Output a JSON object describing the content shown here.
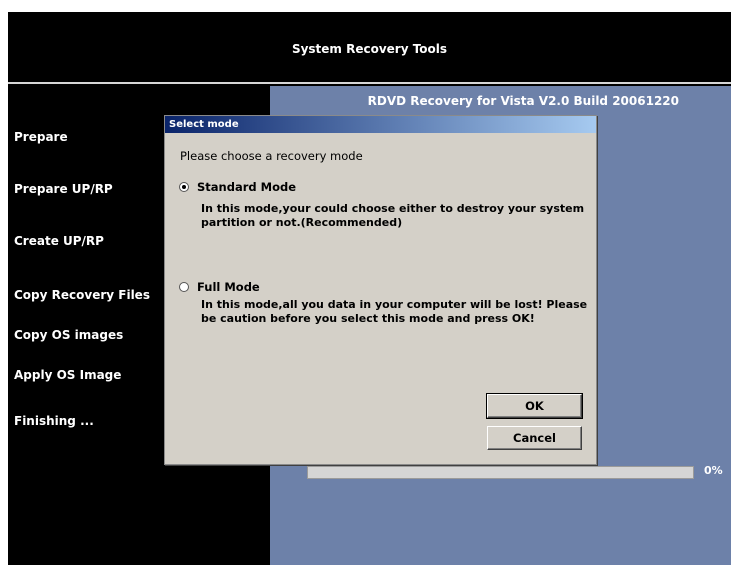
{
  "window": {
    "title": "System Recovery Tools"
  },
  "build_info": "RDVD Recovery for Vista V2.0 Build 20061220",
  "steps": [
    "Prepare",
    "Prepare UP/RP",
    "Create UP/RP",
    "Copy Recovery Files",
    "Copy OS images",
    "Apply OS Image",
    "Finishing ..."
  ],
  "progress": {
    "value": 0,
    "label": "0%"
  },
  "dialog": {
    "title": "Select mode",
    "prompt": "Please choose a recovery mode",
    "options": [
      {
        "label": "Standard Mode",
        "selected": true,
        "description_line1": "In this mode,your could choose either to destroy your system",
        "description_line2": "partition or not.(Recommended)"
      },
      {
        "label": "Full Mode",
        "selected": false,
        "description_line1": "In this mode,all you data in your computer will be lost! Please",
        "description_line2": "be caution before you select this mode and press OK!"
      }
    ],
    "ok_label": "OK",
    "cancel_label": "Cancel"
  },
  "colors": {
    "main_bg": "#6d81a9",
    "dialog_bg": "#d4d0c8",
    "title_gradient_start": "#0a246a"
  }
}
